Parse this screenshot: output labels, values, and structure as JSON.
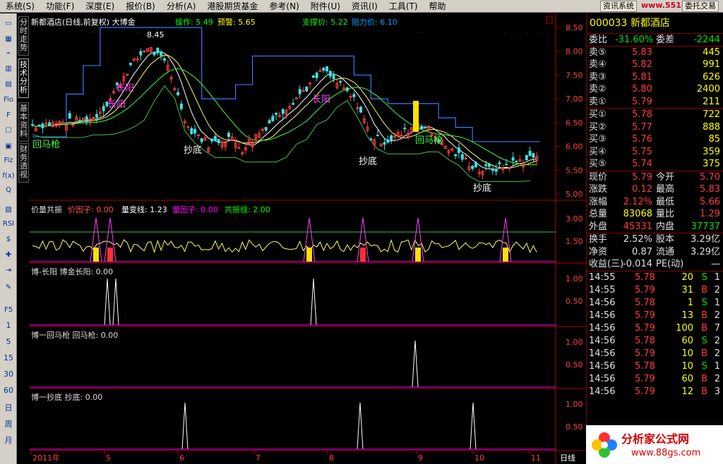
{
  "menu": [
    "系统(S)",
    "功能(F)",
    "深度(E)",
    "报价(B)",
    "分析(A)",
    "港股期货基金",
    "参考(N)",
    "附件(U)",
    "资讯(I)",
    "工具(T)",
    "帮助"
  ],
  "menu_right": {
    "btn1": "资讯系统",
    "btn2": "委托交易",
    "watermark": "www.55188.com"
  },
  "left_tools": [
    "▭",
    "▦",
    "⌁",
    "▥",
    "▤",
    "Fio",
    "F",
    "☐",
    "▣",
    "Fiz",
    "f(x)",
    "Q",
    "▧",
    "RSI",
    "$",
    "✚",
    "⇥",
    "✎",
    "F5"
  ],
  "left_nums": [
    "1",
    "5",
    "15",
    "30",
    "60",
    "日",
    "周",
    "月"
  ],
  "vtabs": [
    "分时走势",
    "技术分析",
    "基本资料",
    "财务透视"
  ],
  "chart": {
    "main_header": {
      "title": "新都酒店(日线,前复权) 大博金",
      "op_label": "操作: 5.49",
      "warn_label": "预警: 5.65",
      "support": "支撑价: 5.22",
      "resist": "阻力价: 6.10"
    },
    "high_label": "8.45",
    "main_labels": [
      "长阳",
      "长阳",
      "长阳",
      "回马枪",
      "抄底",
      "抄底",
      "回马枪",
      "抄底"
    ],
    "main_axis": [
      "8.50",
      "8.00",
      "7.50",
      "7.00",
      "6.50",
      "6.00",
      "5.50",
      "5.00"
    ],
    "vol_header": {
      "name": "价量共振",
      "f1": "价因子: 0.00",
      "f2": "量变线: 1.23",
      "f3": "量因子: 0.00",
      "f4": "共振线: 2.00"
    },
    "vol_axis": [
      "3.00",
      "1.50"
    ],
    "p3_header": "博-长阳  博金长阳: 0.00",
    "p4_header": "博一回马枪  回马枪: 0.00",
    "p5_header": "博一抄底  抄底: 0.00",
    "sub_axis": [
      "1.00",
      "0.50"
    ],
    "dates": [
      "2011年",
      "5",
      "6",
      "7",
      "8",
      "9",
      "10",
      "11"
    ],
    "period": "日线"
  },
  "quote": {
    "code_name": "000033 新都酒店",
    "ratio": {
      "l1": "委比",
      "v1": "-31.60%",
      "l2": "委差",
      "v2": "-2244"
    },
    "sells": [
      {
        "l": "卖⑤",
        "p": "5.83",
        "v": "445"
      },
      {
        "l": "卖④",
        "p": "5.82",
        "v": "991"
      },
      {
        "l": "卖③",
        "p": "5.81",
        "v": "626"
      },
      {
        "l": "卖②",
        "p": "5.80",
        "v": "2400"
      },
      {
        "l": "卖①",
        "p": "5.79",
        "v": "211"
      }
    ],
    "buys": [
      {
        "l": "买①",
        "p": "5.78",
        "v": "722"
      },
      {
        "l": "买②",
        "p": "5.77",
        "v": "888"
      },
      {
        "l": "买③",
        "p": "5.76",
        "v": "85"
      },
      {
        "l": "买④",
        "p": "5.75",
        "v": "359"
      },
      {
        "l": "买⑤",
        "p": "5.74",
        "v": "375"
      }
    ],
    "stats": [
      {
        "l1": "现价",
        "v1": "5.79",
        "l2": "今开",
        "v2": "5.70",
        "c1": "red",
        "c2": "red"
      },
      {
        "l1": "涨跌",
        "v1": "0.12",
        "l2": "最高",
        "v2": "5.83",
        "c1": "red",
        "c2": "red"
      },
      {
        "l1": "涨幅",
        "v1": "2.12%",
        "l2": "最低",
        "v2": "5.66",
        "c1": "red",
        "c2": "red"
      },
      {
        "l1": "总量",
        "v1": "83068",
        "l2": "量比",
        "v2": "1.29",
        "c1": "yel",
        "c2": "red"
      },
      {
        "l1": "外盘",
        "v1": "45331",
        "l2": "内盘",
        "v2": "37737",
        "c1": "red",
        "c2": "grn"
      }
    ],
    "stats2": [
      {
        "l1": "换手",
        "v1": "2.52%",
        "l2": "股本",
        "v2": "3.29亿"
      },
      {
        "l1": "净资",
        "v1": "0.87",
        "l2": "流通",
        "v2": "3.29亿"
      },
      {
        "l1": "收益(三)",
        "v1": "-0.014",
        "l2": "PE(动)",
        "v2": "—"
      }
    ],
    "ticks": [
      {
        "t": "14:55",
        "p": "5.78",
        "v": "20",
        "s": "S",
        "n": "1"
      },
      {
        "t": "14:55",
        "p": "5.79",
        "v": "31",
        "s": "B",
        "n": "2"
      },
      {
        "t": "14:56",
        "p": "5.78",
        "v": "1",
        "s": "S",
        "n": "1"
      },
      {
        "t": "14:56",
        "p": "5.79",
        "v": "13",
        "s": "B",
        "n": "2"
      },
      {
        "t": "14:56",
        "p": "5.79",
        "v": "100",
        "s": "B",
        "n": "7"
      },
      {
        "t": "14:56",
        "p": "5.78",
        "v": "60",
        "s": "S",
        "n": "2"
      },
      {
        "t": "14:56",
        "p": "5.79",
        "v": "10",
        "s": "B",
        "n": "2"
      },
      {
        "t": "14:56",
        "p": "5.78",
        "v": "10",
        "s": "S",
        "n": "1"
      },
      {
        "t": "14:56",
        "p": "5.79",
        "v": "60",
        "s": "B",
        "n": "2"
      },
      {
        "t": "14:56",
        "p": "5.79",
        "v": "12",
        "s": "B",
        "n": "3"
      }
    ]
  },
  "logo": {
    "title": "分析家公式网",
    "url": "www.88gs.com"
  }
}
